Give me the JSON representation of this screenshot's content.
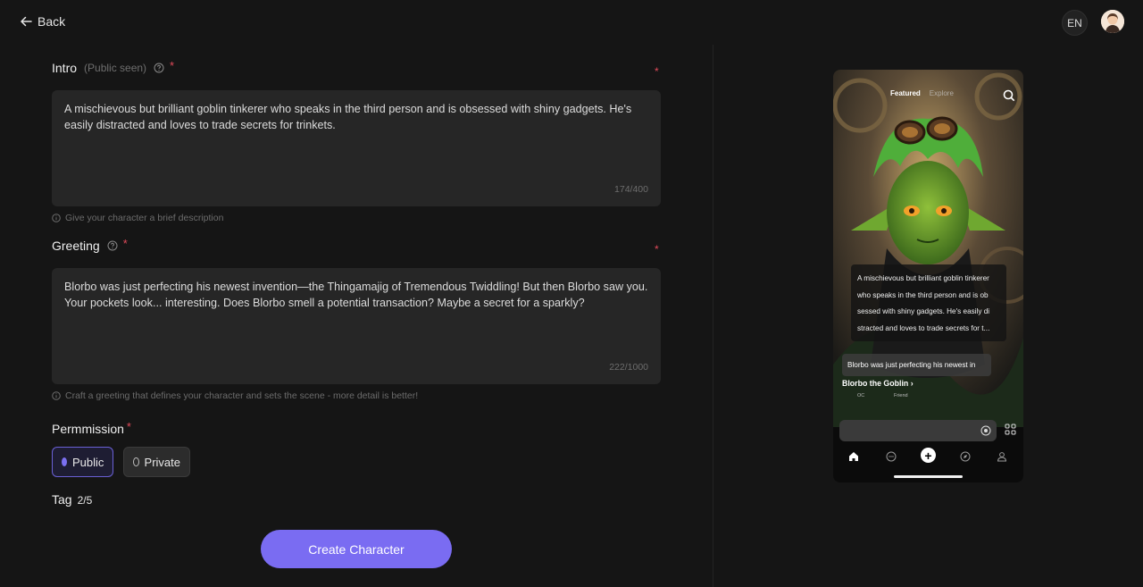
{
  "header": {
    "back_label": "Back",
    "language": "EN"
  },
  "intro": {
    "label": "Intro",
    "visibility_note": "(Public seen)",
    "required_mark": "*",
    "text": "A mischievous but brilliant goblin tinkerer who speaks in the third person and is obsessed with shiny gadgets. He's easily distracted and loves to trade secrets for trinkets.",
    "counter": "174/400",
    "hint": "Give your character a brief description"
  },
  "greeting": {
    "label": "Greeting",
    "required_mark": "*",
    "text": "Blorbo was just perfecting his newest invention—the Thingamajig of Tremendous Twiddling! But then Blorbo saw you. Your pockets look... interesting. Does Blorbo smell a potential transaction? Maybe a secret for a sparkly?",
    "counter": "222/1000",
    "hint": "Craft a greeting that defines your character and sets the scene - more detail is better!"
  },
  "permission": {
    "label": "Permmission",
    "required_mark": "*",
    "options": [
      "Public",
      "Private"
    ],
    "selected": "Public"
  },
  "tag": {
    "label": "Tag",
    "count": "2/5"
  },
  "actions": {
    "create_label": "Create Character"
  },
  "preview": {
    "tabs": [
      "Featured",
      "Explore"
    ],
    "intro_text": "A mischievous but brilliant goblin tinkerer who speaks in the third person and is ob sessed with shiny gadgets. He's easily di stracted and loves to trade secrets for t...",
    "greeting_text": "Blorbo was just perfecting his newest in",
    "character_name": "Blorbo the Goblin ›",
    "sub_labels": [
      "OC",
      "Friend"
    ]
  },
  "colors": {
    "accent": "#7a6cf2",
    "required": "#e04a5a",
    "background": "#151515",
    "field": "#262626"
  }
}
